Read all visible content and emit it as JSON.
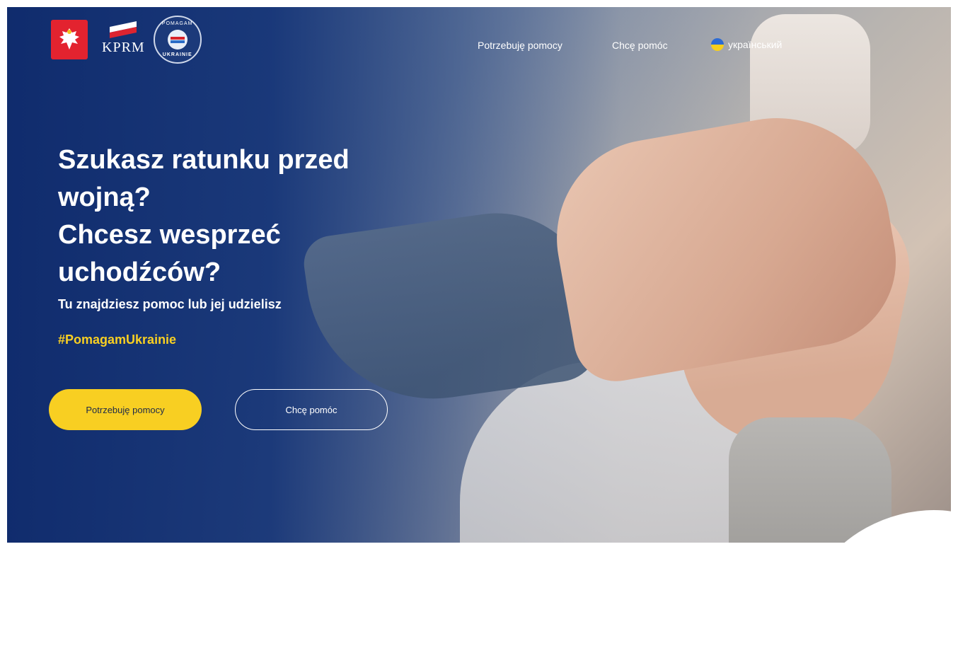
{
  "header": {
    "logos": {
      "emblem": "polish-eagle-emblem",
      "kprm_text": "KPRM",
      "badge_top": "POMAGAM",
      "badge_bottom": "UKRAINIE"
    },
    "nav": {
      "need_help": "Potrzebuję pomocy",
      "want_help": "Chcę pomóc",
      "language": "український"
    }
  },
  "hero": {
    "title_lines": [
      "Szukasz ratunku przed",
      "wojną?",
      "Chcesz wesprzeć",
      "uchodźców?"
    ],
    "subtitle": "Tu znajdziesz pomoc lub jej udzielisz",
    "hashtag": "#PomagamUkrainie",
    "primary_button": "Potrzebuję pomocy",
    "secondary_button": "Chcę pomóc"
  },
  "colors": {
    "navy": "#12306f",
    "yellow": "#f8cf22",
    "emblem_red": "#e3232f"
  }
}
